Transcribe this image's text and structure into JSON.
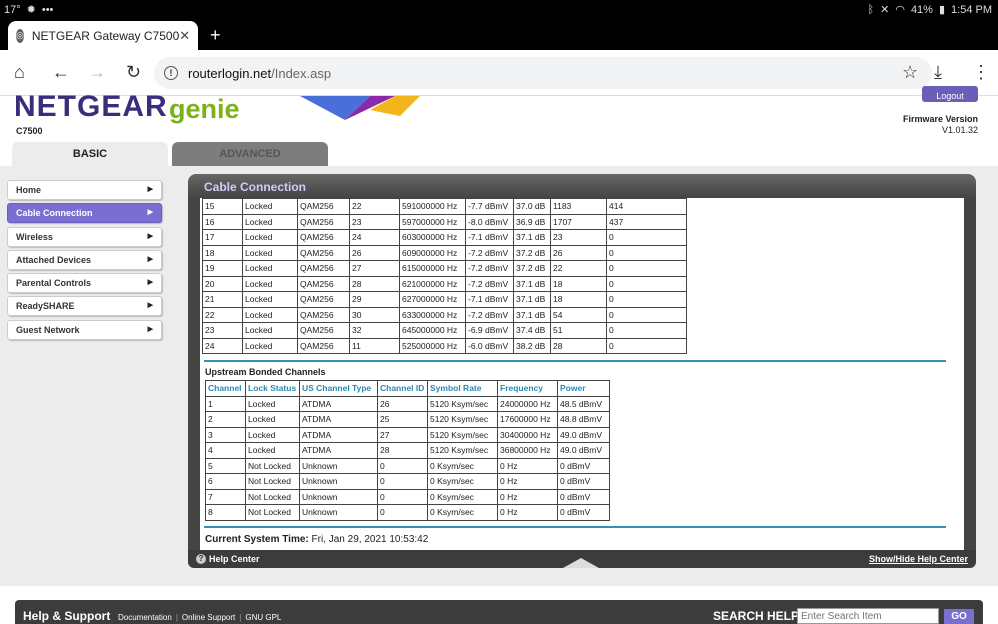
{
  "status_bar": {
    "temp": "17°",
    "more": "•••",
    "battery": "41%",
    "time": "1:54 PM",
    "icons": [
      "sun-icon",
      "bluetooth-icon",
      "mute-icon",
      "wifi-icon",
      "battery-icon"
    ]
  },
  "browser": {
    "tab_title": "NETGEAR Gateway C7500",
    "new_tab": "+",
    "url_host": "routerlogin.net",
    "url_path": "/Index.asp"
  },
  "header": {
    "logo_a": "NETGEAR",
    "logo_b": "genie",
    "model": "C7500",
    "logout": "Logout",
    "firmware_label": "Firmware Version",
    "firmware_version": "V1.01.32",
    "tab_basic": "BASIC",
    "tab_advanced": "ADVANCED"
  },
  "sidebar": {
    "items": [
      {
        "label": "Home"
      },
      {
        "label": "Cable Connection"
      },
      {
        "label": "Wireless"
      },
      {
        "label": "Attached Devices"
      },
      {
        "label": "Parental Controls"
      },
      {
        "label": "ReadySHARE"
      },
      {
        "label": "Guest Network"
      }
    ]
  },
  "panel": {
    "title": "Cable Connection",
    "downstream_rows": [
      [
        "15",
        "Locked",
        "QAM256",
        "22",
        "591000000 Hz",
        "-7.7 dBmV",
        "37.0 dB",
        "1183",
        "414"
      ],
      [
        "16",
        "Locked",
        "QAM256",
        "23",
        "597000000 Hz",
        "-8.0 dBmV",
        "36.9 dB",
        "1707",
        "437"
      ],
      [
        "17",
        "Locked",
        "QAM256",
        "24",
        "603000000 Hz",
        "-7.1 dBmV",
        "37.1 dB",
        "23",
        "0"
      ],
      [
        "18",
        "Locked",
        "QAM256",
        "26",
        "609000000 Hz",
        "-7.2 dBmV",
        "37.2 dB",
        "26",
        "0"
      ],
      [
        "19",
        "Locked",
        "QAM256",
        "27",
        "615000000 Hz",
        "-7.2 dBmV",
        "37.2 dB",
        "22",
        "0"
      ],
      [
        "20",
        "Locked",
        "QAM256",
        "28",
        "621000000 Hz",
        "-7.2 dBmV",
        "37.1 dB",
        "18",
        "0"
      ],
      [
        "21",
        "Locked",
        "QAM256",
        "29",
        "627000000 Hz",
        "-7.1 dBmV",
        "37.1 dB",
        "18",
        "0"
      ],
      [
        "22",
        "Locked",
        "QAM256",
        "30",
        "633000000 Hz",
        "-7.2 dBmV",
        "37.1 dB",
        "54",
        "0"
      ],
      [
        "23",
        "Locked",
        "QAM256",
        "32",
        "645000000 Hz",
        "-6.9 dBmV",
        "37.4 dB",
        "51",
        "0"
      ],
      [
        "24",
        "Locked",
        "QAM256",
        "11",
        "525000000 Hz",
        "-6.0 dBmV",
        "38.2 dB",
        "28",
        "0"
      ]
    ],
    "upstream_title": "Upstream Bonded Channels",
    "upstream_headers": [
      "Channel",
      "Lock Status",
      "US Channel Type",
      "Channel ID",
      "Symbol Rate",
      "Frequency",
      "Power"
    ],
    "upstream_rows": [
      [
        "1",
        "Locked",
        "ATDMA",
        "26",
        "5120 Ksym/sec",
        "24000000 Hz",
        "48.5 dBmV"
      ],
      [
        "2",
        "Locked",
        "ATDMA",
        "25",
        "5120 Ksym/sec",
        "17600000 Hz",
        "48.8 dBmV"
      ],
      [
        "3",
        "Locked",
        "ATDMA",
        "27",
        "5120 Ksym/sec",
        "30400000 Hz",
        "49.0 dBmV"
      ],
      [
        "4",
        "Locked",
        "ATDMA",
        "28",
        "5120 Ksym/sec",
        "36800000 Hz",
        "49.0 dBmV"
      ],
      [
        "5",
        "Not Locked",
        "Unknown",
        "0",
        "0 Ksym/sec",
        "0 Hz",
        "0 dBmV"
      ],
      [
        "6",
        "Not Locked",
        "Unknown",
        "0",
        "0 Ksym/sec",
        "0 Hz",
        "0 dBmV"
      ],
      [
        "7",
        "Not Locked",
        "Unknown",
        "0",
        "0 Ksym/sec",
        "0 Hz",
        "0 dBmV"
      ],
      [
        "8",
        "Not Locked",
        "Unknown",
        "0",
        "0 Ksym/sec",
        "0 Hz",
        "0 dBmV"
      ]
    ],
    "system_time_label": "Current System Time:",
    "system_time_value": "Fri, Jan 29, 2021 10:53:42",
    "help_center": "Help Center",
    "show_hide_help": "Show/Hide Help Center"
  },
  "footer": {
    "help_support": "Help & Support",
    "links": [
      "Documentation",
      "Online Support",
      "GNU GPL"
    ],
    "search_label": "SEARCH HELP",
    "search_placeholder": "Enter Search Item",
    "go": "GO"
  },
  "colors": {
    "accent": "#7a6fd0",
    "brand_purple": "#3b2d7a",
    "brand_green": "#7ab317",
    "table_header": "#2a8ab3"
  }
}
